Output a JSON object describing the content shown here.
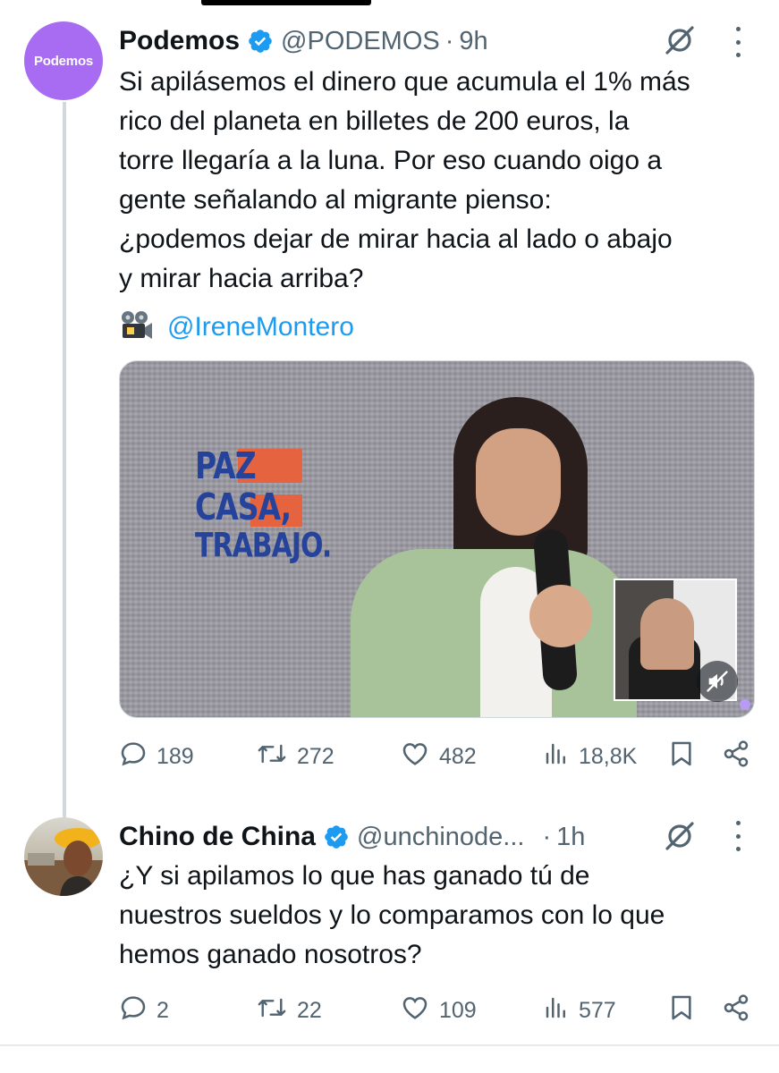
{
  "tweets": [
    {
      "avatar_text": "Podemos",
      "name": "Podemos",
      "handle": "@PODEMOS",
      "separator": "·",
      "time": "9h",
      "text": "Si apilásemos el dinero que acumula el 1% más\nrico del planeta en billetes de 200 euros, la\ntorre llegaría a la luna. Por eso cuando oigo a\ngente señalando al migrante pienso:\n¿podemos dejar de mirar hacia al lado o abajo\ny mirar hacia arriba?",
      "mention": "@IreneMontero",
      "video_logo": [
        "PAZ",
        "CASA,",
        "TRABAJO."
      ],
      "stats": {
        "replies": "189",
        "retweets": "272",
        "likes": "482",
        "views": "18,8K"
      }
    },
    {
      "name": "Chino de China",
      "handle": "@unchinode...",
      "separator": "·",
      "time": "1h",
      "text": "¿Y si apilamos lo que has ganado tú de\nnuestros sueldos y lo comparamos con lo que\nhemos ganado nosotros?",
      "stats": {
        "replies": "2",
        "retweets": "22",
        "likes": "109",
        "views": "577"
      }
    }
  ],
  "colors": {
    "link": "#1d9bf0",
    "verified": "#1d9bf0",
    "muted": "#536471",
    "podemos_avatar": "#a76cf2"
  },
  "icons": [
    "verified-badge-icon",
    "grok-icon",
    "more-icon",
    "film-projector-icon",
    "mute-icon",
    "reply-icon",
    "retweet-icon",
    "like-icon",
    "views-icon",
    "bookmark-icon",
    "share-icon"
  ]
}
